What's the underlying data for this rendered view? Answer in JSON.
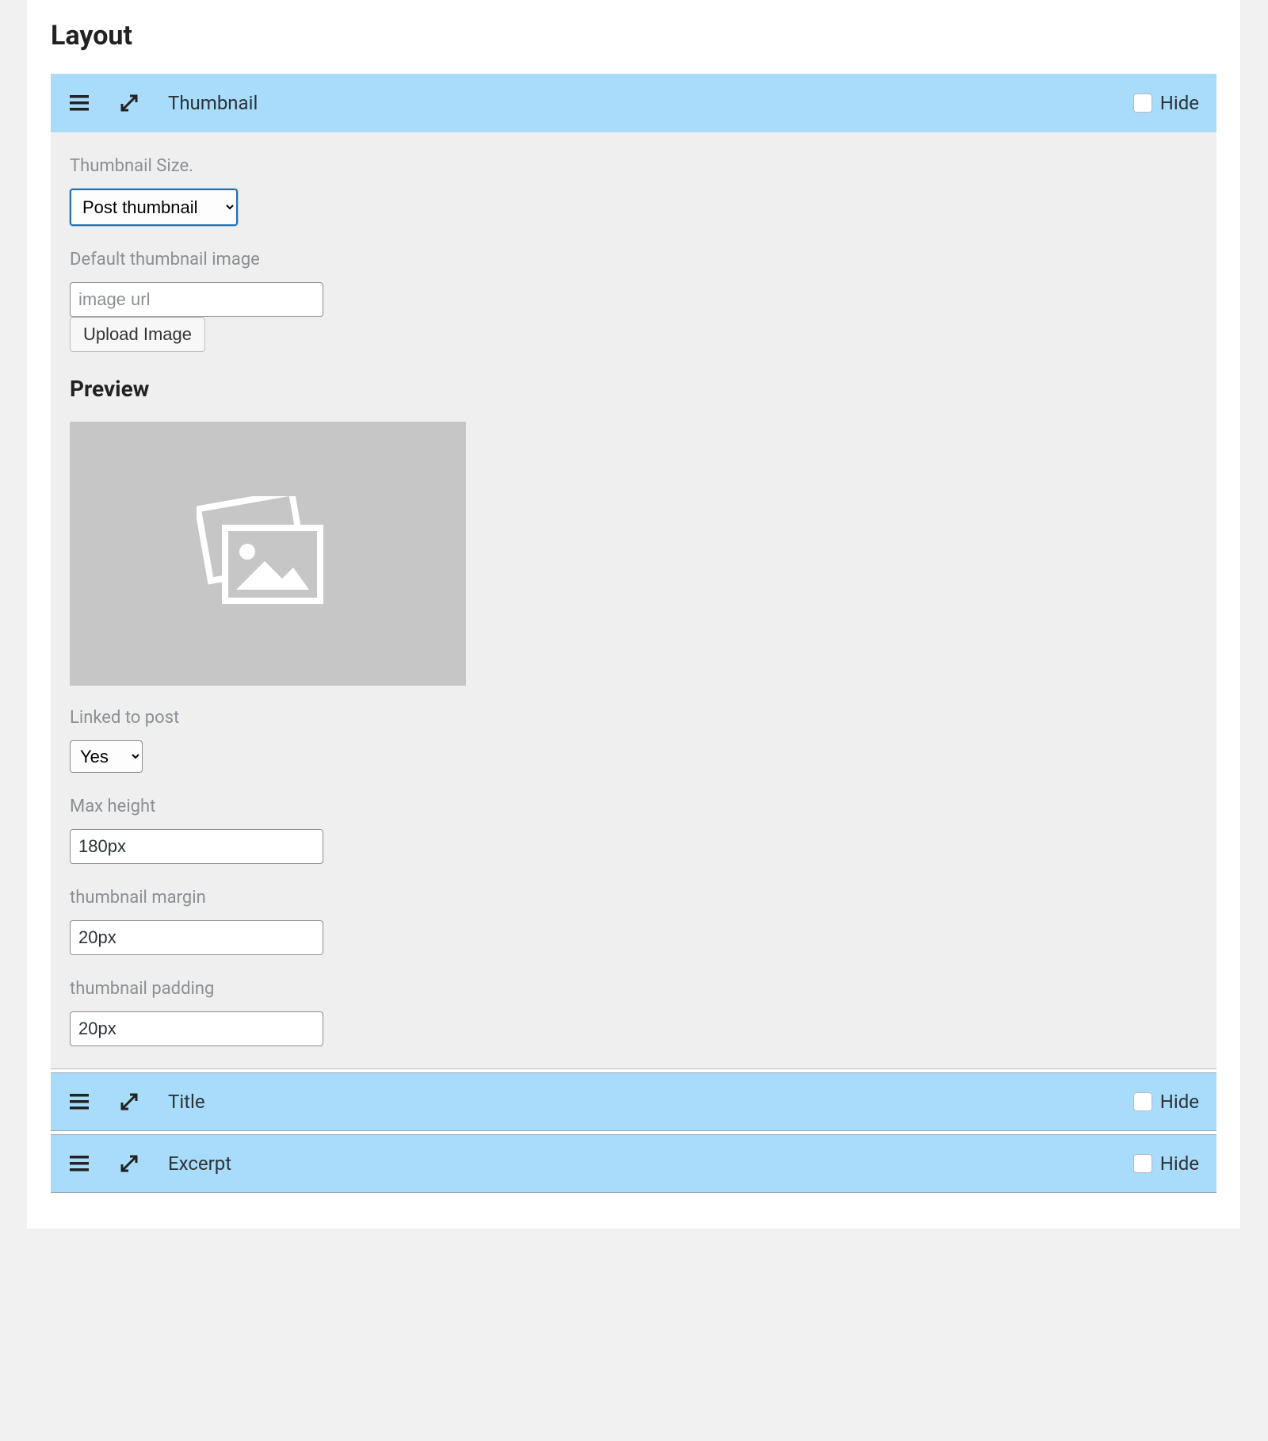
{
  "heading": "Layout",
  "sections": {
    "thumbnail": {
      "title": "Thumbnail",
      "hide_label": "Hide",
      "fields": {
        "thumbnail_size_label": "Thumbnail Size.",
        "thumbnail_size_value": "Post thumbnail",
        "default_image_label": "Default thumbnail image",
        "default_image_placeholder": "image url",
        "upload_button": "Upload Image",
        "preview_heading": "Preview",
        "linked_label": "Linked to post",
        "linked_value": "Yes",
        "max_height_label": "Max height",
        "max_height_value": "180px",
        "margin_label": "thumbnail margin",
        "margin_value": "20px",
        "padding_label": "thumbnail padding",
        "padding_value": "20px"
      }
    },
    "title": {
      "title": "Title",
      "hide_label": "Hide"
    },
    "excerpt": {
      "title": "Excerpt",
      "hide_label": "Hide"
    }
  }
}
